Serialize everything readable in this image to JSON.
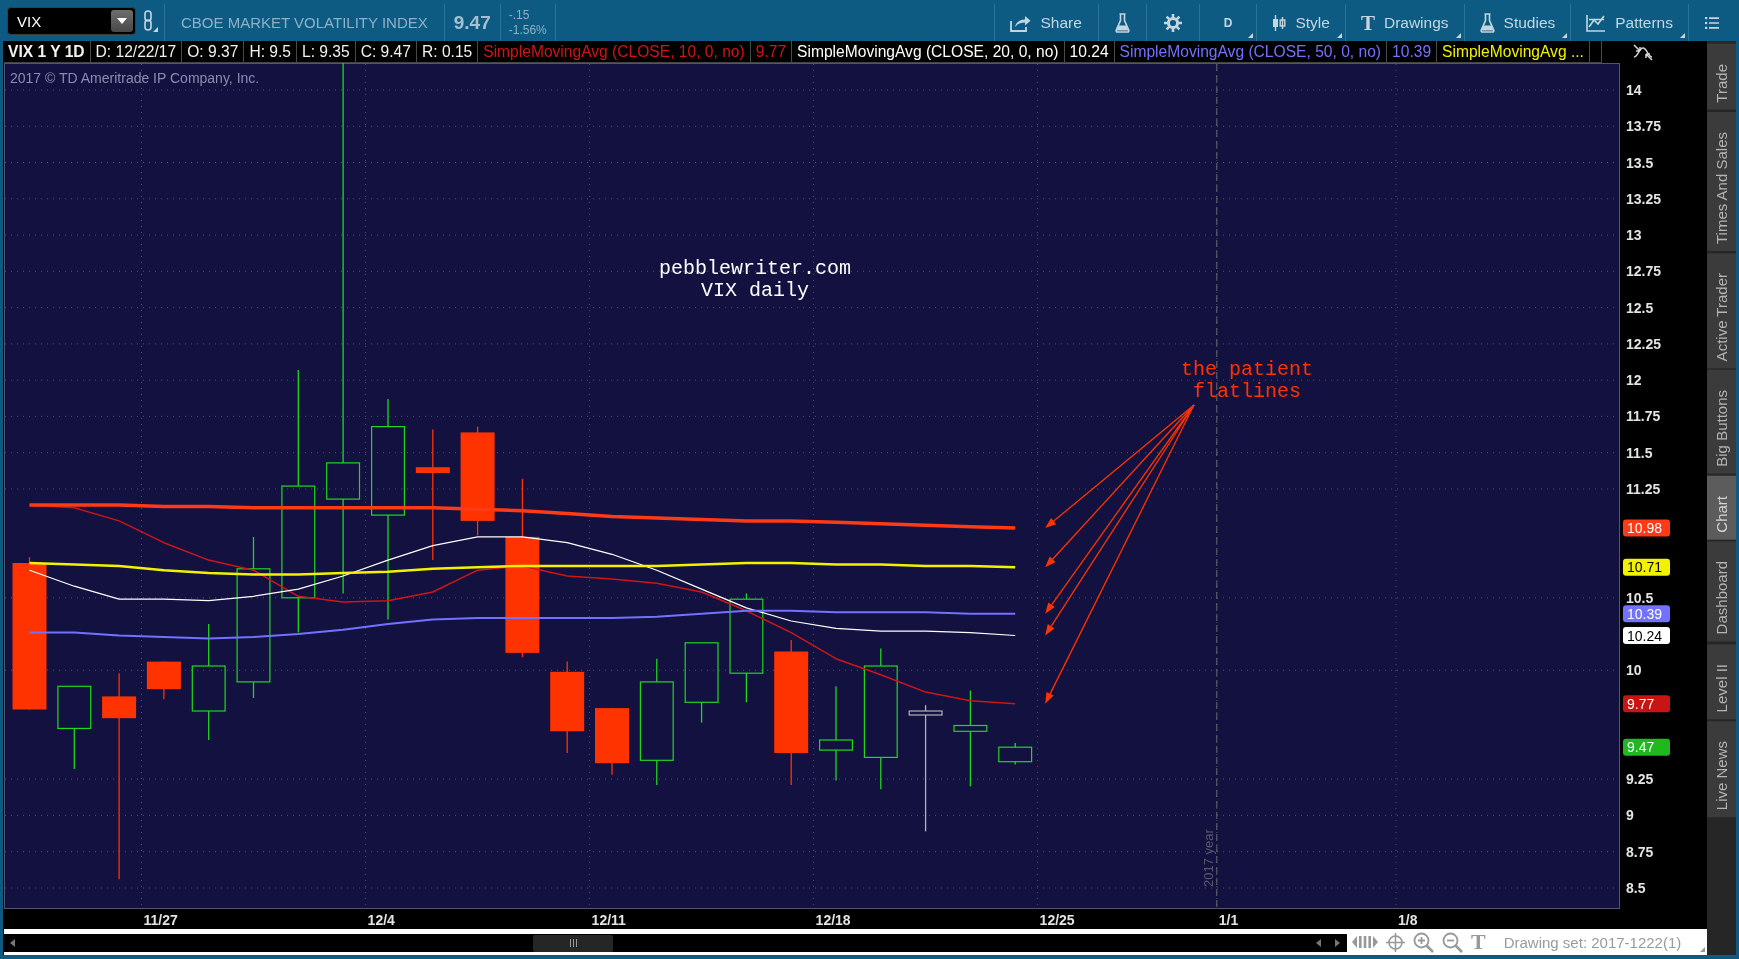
{
  "toolbar": {
    "symbol": "VIX",
    "description": "CBOE MARKET VOLATILITY INDEX",
    "last": "9.47",
    "change": "-.15",
    "change_percent": "-1.56%",
    "buttons": [
      {
        "kind": "share",
        "label": "Share",
        "menu": false
      },
      {
        "kind": "flask",
        "menu": false
      },
      {
        "kind": "gear",
        "menu": false
      },
      {
        "kind": "aggregation",
        "label": "D",
        "menu": true
      },
      {
        "kind": "style",
        "label": "Style",
        "menu": true
      },
      {
        "kind": "drawings",
        "glyph": "T",
        "label": "Drawings",
        "menu": true
      },
      {
        "kind": "studies",
        "label": "Studies",
        "menu": true
      },
      {
        "kind": "patterns",
        "label": "Patterns",
        "menu": true
      },
      {
        "kind": "list",
        "menu": false
      }
    ]
  },
  "legend": {
    "title": "VIX 1 Y 1D",
    "cells": [
      "D: 12/22/17",
      "O: 9.37",
      "H: 9.5",
      "L: 9.35",
      "C: 9.47",
      "R: 0.15"
    ],
    "studies": [
      {
        "name": "SimpleMovingAvg (CLOSE, 10, 0, no)",
        "value": "9.77"
      },
      {
        "name": "SimpleMovingAvg (CLOSE, 20, 0, no)",
        "value": "10.24"
      },
      {
        "name": "SimpleMovingAvg (CLOSE, 50, 0, no)",
        "value": "10.39"
      },
      {
        "name": "SimpleMovingAvg ..."
      }
    ]
  },
  "chart": {
    "copyright": "2017 © TD Ameritrade IP Company, Inc.",
    "date_labels": [
      "11/27",
      "12/4",
      "12/11",
      "12/18",
      "12/25",
      "1/1",
      "1/8"
    ],
    "price_tags": [
      {
        "text": "10.98",
        "color": "#ff3a14"
      },
      {
        "text": "10.71",
        "color": "#f2f200"
      },
      {
        "text": "10.39",
        "color": "#7272ff"
      },
      {
        "text": "10.24",
        "color": "#ffffff"
      },
      {
        "text": "9.77",
        "color": "#c81414"
      },
      {
        "text": "9.47",
        "color": "#1fb81f"
      }
    ],
    "chart_data": {
      "type": "line",
      "grid": true,
      "ylim": [
        8.355,
        14.186
      ],
      "yticks": [
        14,
        13.75,
        13.5,
        13.25,
        13,
        12.75,
        12.5,
        12.25,
        12,
        11.75,
        11.5,
        11.25,
        10.5,
        10,
        9.25,
        9,
        8.75,
        8.5
      ],
      "series": [
        {
          "color": "#d01515",
          "values": [
            11.14,
            11.12,
            11.03,
            10.88,
            10.76,
            10.69,
            10.51,
            10.47,
            10.48,
            10.54,
            10.69,
            10.72,
            10.65,
            10.63,
            10.6,
            10.54,
            10.41,
            10.26,
            10.08,
            9.97,
            9.85,
            9.79,
            9.77
          ]
        },
        {
          "color": "#ffffff",
          "values": [
            10.69,
            10.58,
            10.49,
            10.49,
            10.48,
            10.51,
            10.56,
            10.65,
            10.76,
            10.86,
            10.92,
            10.92,
            10.88,
            10.8,
            10.69,
            10.56,
            10.43,
            10.34,
            10.29,
            10.27,
            10.27,
            10.26,
            10.24
          ]
        },
        {
          "color": "#7272ff",
          "values": [
            10.26,
            10.26,
            10.24,
            10.23,
            10.22,
            10.23,
            10.25,
            10.28,
            10.32,
            10.35,
            10.36,
            10.36,
            10.36,
            10.36,
            10.37,
            10.39,
            10.41,
            10.41,
            10.4,
            10.4,
            10.4,
            10.39,
            10.39
          ]
        },
        {
          "color": "#f2f200",
          "values": [
            10.74,
            10.73,
            10.72,
            10.69,
            10.67,
            10.66,
            10.66,
            10.67,
            10.68,
            10.7,
            10.71,
            10.72,
            10.72,
            10.72,
            10.72,
            10.73,
            10.74,
            10.74,
            10.73,
            10.73,
            10.72,
            10.72,
            10.71
          ]
        },
        {
          "color": "#ff3a14",
          "values": [
            11.14,
            11.14,
            11.14,
            11.13,
            11.13,
            11.12,
            11.12,
            11.12,
            11.12,
            11.12,
            11.11,
            11.1,
            11.08,
            11.06,
            11.05,
            11.04,
            11.03,
            11.03,
            11.02,
            11.01,
            11.0,
            10.99,
            10.98
          ]
        }
      ],
      "annotations": [
        "pebblewriter.com",
        "VIX daily",
        "the patient",
        "flatlines",
        "2017 year"
      ]
    }
  },
  "side_tabs": [
    {
      "label": "Trade",
      "selected": false
    },
    {
      "label": "Times And Sales",
      "selected": false
    },
    {
      "label": "Active Trader",
      "selected": false
    },
    {
      "label": "Big Buttons",
      "selected": false
    },
    {
      "label": "Chart",
      "selected": true
    },
    {
      "label": "Dashboard",
      "selected": false
    },
    {
      "label": "Level II",
      "selected": false
    },
    {
      "label": "Live News",
      "selected": false
    }
  ],
  "bottom_bar": {
    "text_tool": "T",
    "drawing_set": "Drawing set: 2017-1222(1)"
  }
}
